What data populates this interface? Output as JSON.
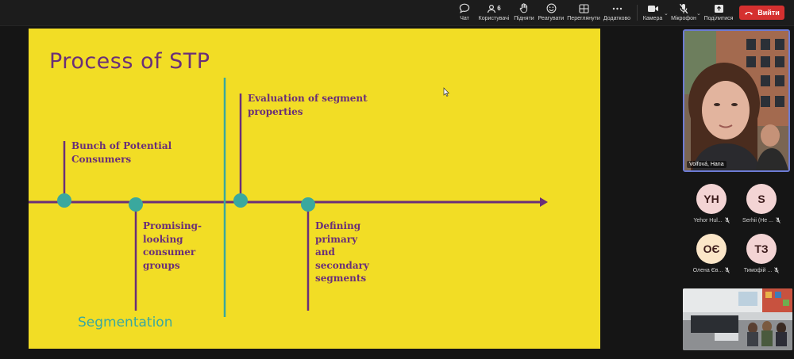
{
  "toolbar": {
    "chat": "Чат",
    "participants": "Користувачі",
    "participants_count": "6",
    "raise_hand": "Підняти",
    "react": "Реагувати",
    "view": "Переглянути",
    "more": "Додатково",
    "camera": "Камера",
    "microphone": "Мікрофон",
    "share": "Поділитися",
    "leave": "Вийти",
    "leave_color": "#d5302f"
  },
  "slide": {
    "background": "#f2dd25",
    "title": "Process of STP",
    "label_bunch_1": "Bunch of Potential",
    "label_bunch_2": "Consumers",
    "label_promising_1": "Promising-",
    "label_promising_2": "looking",
    "label_promising_3": "consumer",
    "label_promising_4": "groups",
    "label_eval_1": "Evaluation of segment",
    "label_eval_2": "properties",
    "label_define_1": "Defining",
    "label_define_2": "primary",
    "label_define_3": "and",
    "label_define_4": "secondary",
    "label_define_5": "segments",
    "phase_label": "Segmentation",
    "accent_purple": "#6a2f78",
    "accent_teal": "#3aa89e"
  },
  "participants": {
    "speaker_name": "Volfová, Hana",
    "tiles": [
      {
        "initials": "YH",
        "name": "Yehor Hul...",
        "color": "#f3d4d4"
      },
      {
        "initials": "S",
        "name": "Serhii (He ...",
        "color": "#f3d4d4"
      },
      {
        "initials": "ОЄ",
        "name": "Олена Єв...",
        "color": "#fbe6c8"
      },
      {
        "initials": "ТЗ",
        "name": "Тимофій ...",
        "color": "#f3d4d4"
      }
    ]
  },
  "icons": {
    "chat": "chat-bubble-icon",
    "participants": "people-icon",
    "raise_hand": "hand-icon",
    "react": "smile-icon",
    "view": "grid-icon",
    "more": "dots-icon",
    "camera": "video-camera-icon",
    "microphone": "microphone-off-icon",
    "share": "share-screen-icon",
    "leave": "phone-hangup-icon"
  }
}
